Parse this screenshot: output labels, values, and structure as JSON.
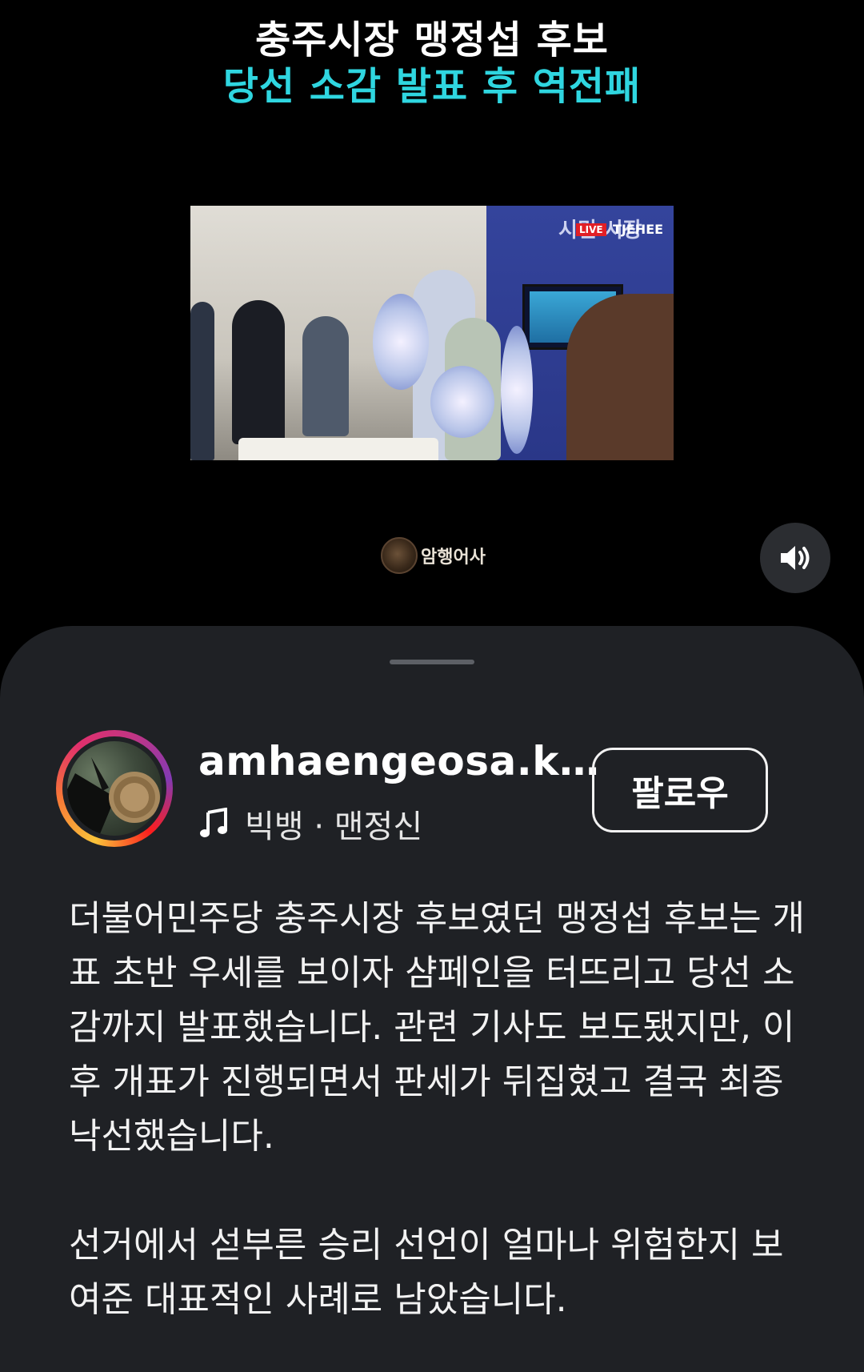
{
  "video": {
    "title_line1": "충주시장 맹정섭 후보",
    "title_line2": "당선 소감 발표 후 역전패",
    "title_line2_color": "#2fd6e0",
    "live_badge": "LIVE",
    "channel_tag": "TJEHEE",
    "watermark_text": "암행어사",
    "sound_icon": "speaker-volume-icon"
  },
  "profile": {
    "username": "amhaengeosa.k…",
    "music_icon": "music-note-icon",
    "music_text": "빅뱅 · 맨정신",
    "follow_label": "팔로우"
  },
  "caption": {
    "paragraph1": "더불어민주당 충주시장 후보였던 맹정섭 후보는 개표 초반 우세를 보이자 샴페인을 터뜨리고 당선 소감까지 발표했습니다. 관련 기사도 보도됐지만, 이후 개표가 진행되면서 판세가 뒤집혔고 결국 최종 낙선했습니다.",
    "paragraph2": "선거에서 섣부른 승리 선언이 얼마나 위험한지 보여준 대표적인 사례로 남았습니다."
  }
}
